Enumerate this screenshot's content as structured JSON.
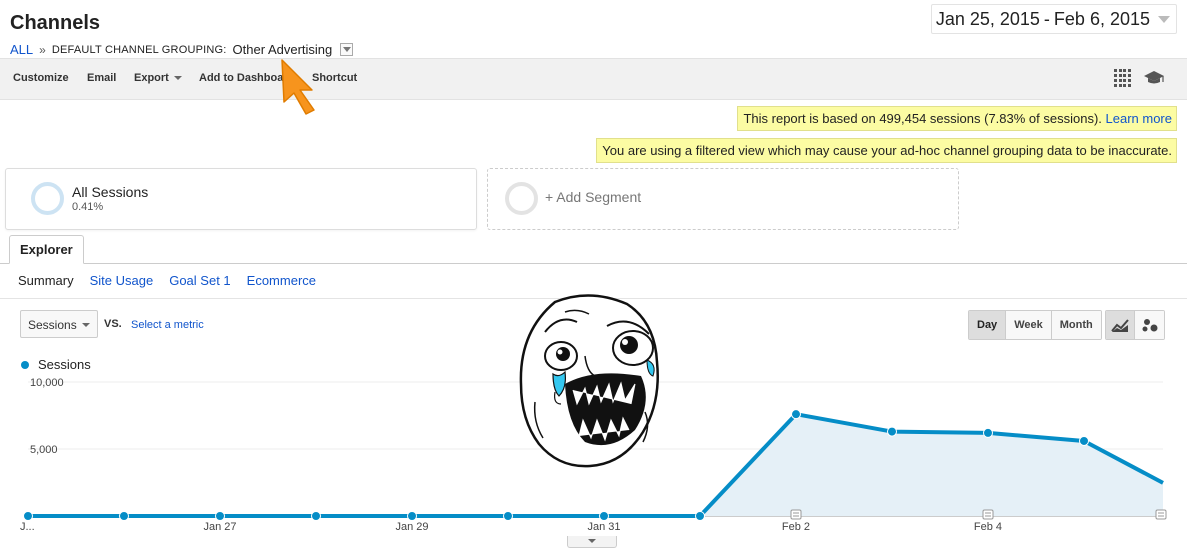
{
  "header": {
    "title": "Channels",
    "breadcrumb": {
      "all": "ALL",
      "sep": "»",
      "grouping_label": "DEFAULT CHANNEL GROUPING:",
      "grouping_value": "Other Advertising"
    },
    "date_range": {
      "start": "Jan 25, 2015",
      "sep": "-",
      "end": "Feb 6, 2015"
    }
  },
  "toolbar": {
    "customize": "Customize",
    "email": "Email",
    "export": "Export",
    "add_to_dashboard": "Add to Dashboard",
    "shortcut": "Shortcut",
    "icons": [
      "grid-icon",
      "graduation-cap-icon"
    ]
  },
  "notices": {
    "sampling_text": "This report is based on 499,454 sessions (7.83% of sessions).",
    "sampling_link": "Learn more",
    "filtered_view": "You are using a filtered view which may cause your ad-hoc channel grouping data to be inaccurate."
  },
  "segments": {
    "primary": {
      "name": "All Sessions",
      "percent": "0.41%"
    },
    "add": "+ Add Segment"
  },
  "explorer": {
    "tab": "Explorer",
    "subtabs": [
      "Summary",
      "Site Usage",
      "Goal Set 1",
      "Ecommerce"
    ],
    "active_subtab": "Summary"
  },
  "controls": {
    "metric": "Sessions",
    "vs": "VS.",
    "select_metric": "Select a metric",
    "periods": [
      "Day",
      "Week",
      "Month"
    ],
    "active_period": "Day",
    "view_icons": [
      "line-chart-icon",
      "motion-chart-icon"
    ]
  },
  "colors": {
    "series": "#058dc7",
    "area_fill": "#e5f0f7",
    "notice_bg": "#fcfca3",
    "pointer": "#f7941d"
  },
  "chart_data": {
    "type": "area",
    "series": [
      {
        "name": "Sessions",
        "values": [
          0,
          0,
          0,
          0,
          0,
          0,
          0,
          0,
          7600,
          6300,
          6200,
          5600,
          1800
        ]
      }
    ],
    "x": [
      "Jan 25",
      "Jan 26",
      "Jan 27",
      "Jan 28",
      "Jan 29",
      "Jan 30",
      "Jan 31",
      "Feb 1",
      "Feb 2",
      "Feb 3",
      "Feb 4",
      "Feb 5",
      "Feb 6"
    ],
    "x_tick_labels": [
      "J...",
      "",
      "Jan 27",
      "",
      "Jan 29",
      "",
      "Jan 31",
      "",
      "Feb 2",
      "",
      "Feb 4",
      "",
      ""
    ],
    "y_ticks": [
      "10,000",
      "5,000"
    ],
    "y_tick_values": [
      10000,
      5000
    ],
    "ylim": [
      0,
      10000
    ],
    "annotation_dates": [
      "Feb 2",
      "Feb 4",
      "Feb 6"
    ],
    "grid": true
  }
}
